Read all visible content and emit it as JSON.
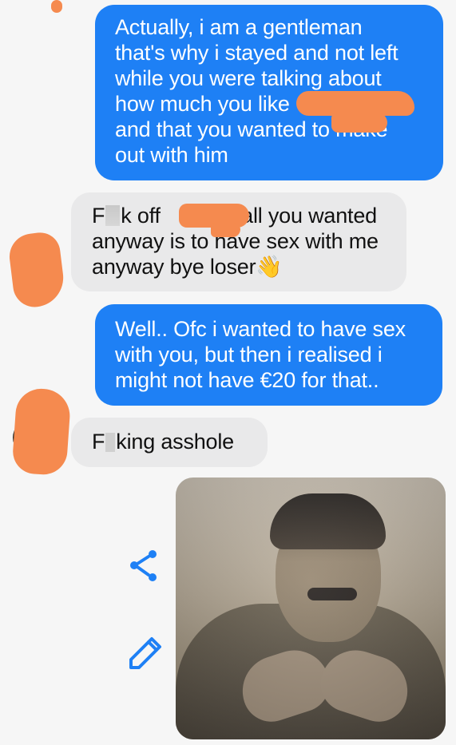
{
  "messages": {
    "out1": {
      "lines": [
        "Actually, i am a gentleman",
        "that's why i stayed and not left",
        "while you were talking about",
        "how much you like",
        "and that you wanted to make",
        "out with him"
      ]
    },
    "in1": {
      "line1_a": "F",
      "line1_b": "k off",
      "line1_c": "all you wanted",
      "line2": "anyway is to have sex with me",
      "line3": "anyway bye loser👋"
    },
    "out2": {
      "lines": [
        "Well.. Ofc i wanted to have sex",
        "with you, but then i realised i",
        "might not have €20 for that.."
      ]
    },
    "in2": {
      "a": "F",
      "b": "king asshole"
    }
  },
  "icons": {
    "share": "share-icon",
    "edit": "edit-icon"
  },
  "colors": {
    "outgoing": "#1e80f5",
    "incoming": "#e9e9ea",
    "redaction": "#f58a4f"
  }
}
